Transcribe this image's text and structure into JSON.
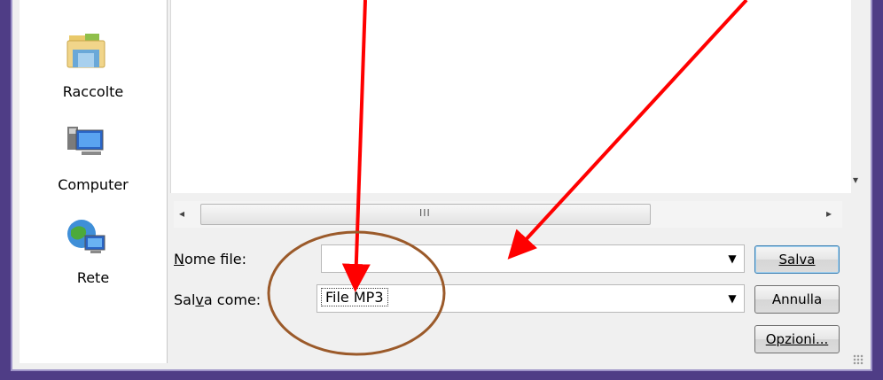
{
  "places": [
    {
      "label": "Raccolte",
      "icon": "folder-libraries-icon"
    },
    {
      "label": "Computer",
      "icon": "computer-icon"
    },
    {
      "label": "Rete",
      "icon": "network-globe-icon"
    }
  ],
  "filename": {
    "label": "Nome file:",
    "accesskey": "N",
    "value": ""
  },
  "savetype": {
    "label": "Salva come:",
    "accesskey": "v",
    "value": "File MP3"
  },
  "buttons": {
    "save": "Salva",
    "cancel": "Annulla",
    "options": "Opzioni..."
  },
  "scrollbar": {
    "grip": "III"
  },
  "annotation_colors": {
    "arrow": "#ff0000",
    "circle": "#9b5a2a"
  },
  "colors": {
    "frame": "#4f3d86",
    "dialog_bg": "#f0f0f0"
  }
}
